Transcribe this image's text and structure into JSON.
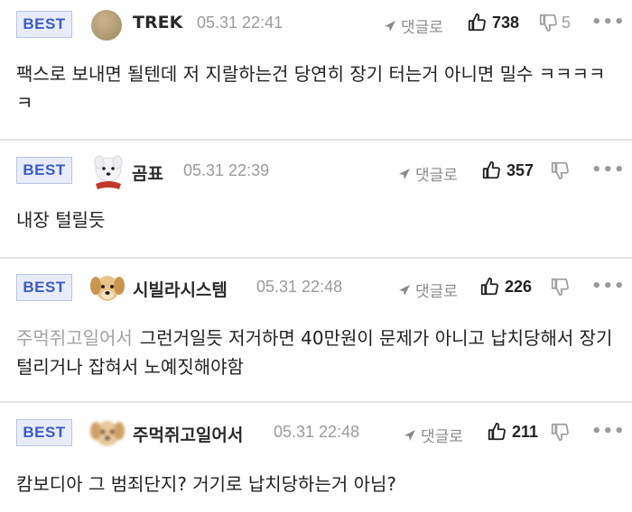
{
  "colors": {
    "badge_bg": "#e7ecf8",
    "badge_text": "#3b5cc4",
    "divider": "#e3e3e3"
  },
  "comments": [
    {
      "badge": "BEST",
      "avatar": "brown-circle-avatar",
      "nickname": "TREK",
      "date": "05.31 22:41",
      "reply_label": "댓글로",
      "likes": "738",
      "dislikes": "5",
      "more": "•••",
      "mention": "",
      "text": "팩스로 보내면 될텐데 저 지랄하는건 당연히 장기 터는거 아니면 밀수 ㅋㅋㅋㅋㅋ"
    },
    {
      "badge": "BEST",
      "avatar": "white-dog-avatar",
      "nickname": "곰표",
      "date": "05.31 22:39",
      "reply_label": "댓글로",
      "likes": "357",
      "dislikes": "",
      "more": "•••",
      "mention": "",
      "text": "내장 털릴듯"
    },
    {
      "badge": "BEST",
      "avatar": "puppy-avatar",
      "nickname": "시빌라시스템",
      "date": "05.31 22:48",
      "reply_label": "댓글로",
      "likes": "226",
      "dislikes": "",
      "more": "•••",
      "mention": "주먹쥐고일어서",
      "text": "그런거일듯 저거하면 40만원이 문제가 아니고 납치당해서 장기털리거나 잡혀서 노예짓해야함"
    },
    {
      "badge": "BEST",
      "avatar": "blurred-puppy-avatar",
      "nickname": "주먹쥐고일어서",
      "date": "05.31 22:48",
      "reply_label": "댓글로",
      "likes": "211",
      "dislikes": "",
      "more": "•••",
      "mention": "",
      "text": "캄보디아 그 범죄단지? 거기로 납치당하는거 아님?"
    }
  ]
}
